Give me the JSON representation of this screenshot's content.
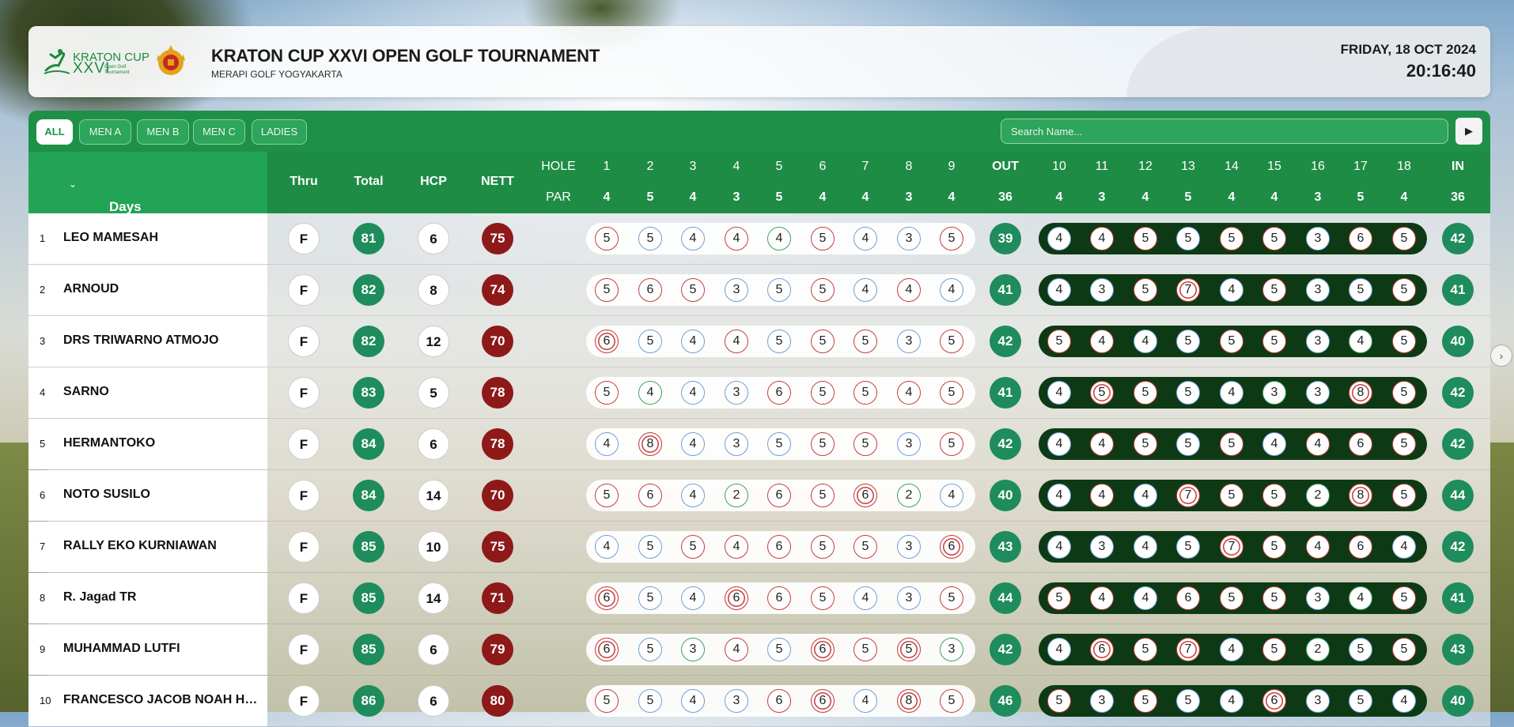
{
  "header": {
    "logo_line1": "KRATON CUP",
    "logo_line2": "XXVI",
    "logo_small": "Open Golf Tournament",
    "title": "KRATON CUP XXVI OPEN GOLF TOURNAMENT",
    "subtitle": "MERAPI GOLF YOGYAKARTA",
    "date": "FRIDAY, 18 OCT 2024",
    "time": "20:16:40"
  },
  "filters": [
    "ALL",
    "MEN A",
    "MEN B",
    "MEN C",
    "LADIES"
  ],
  "active_filter": "ALL",
  "search": {
    "placeholder": "Search Name..."
  },
  "go_icon": "play-icon",
  "columns": {
    "days": "Days",
    "thru": "Thru",
    "total": "Total",
    "hcp": "HCP",
    "nett": "NETT",
    "hole": "HOLE",
    "par": "PAR",
    "out": "OUT",
    "in": "IN",
    "holes": [
      "1",
      "2",
      "3",
      "4",
      "5",
      "6",
      "7",
      "8",
      "9",
      "10",
      "11",
      "12",
      "13",
      "14",
      "15",
      "16",
      "17",
      "18"
    ],
    "pars": [
      "4",
      "5",
      "4",
      "3",
      "5",
      "4",
      "4",
      "3",
      "4",
      "4",
      "3",
      "4",
      "5",
      "4",
      "4",
      "3",
      "5",
      "4"
    ],
    "out_par": "36",
    "in_par": "36"
  },
  "colors": {
    "green": "#1f9048",
    "dark_green": "#0d3a14",
    "nett_red": "#8e1919",
    "total_green": "#1e8c5c"
  },
  "players": [
    {
      "rank": "1",
      "name": "LEO MAMESAH",
      "thru": "F",
      "total": "81",
      "hcp": "6",
      "nett": "75",
      "out": "39",
      "in": "42",
      "scores": [
        "5",
        "5",
        "4",
        "4",
        "4",
        "5",
        "4",
        "3",
        "5",
        "4",
        "4",
        "5",
        "5",
        "5",
        "5",
        "3",
        "6",
        "5"
      ]
    },
    {
      "rank": "2",
      "name": "ARNOUD",
      "thru": "F",
      "total": "82",
      "hcp": "8",
      "nett": "74",
      "out": "41",
      "in": "41",
      "scores": [
        "5",
        "6",
        "5",
        "3",
        "5",
        "5",
        "4",
        "4",
        "4",
        "4",
        "3",
        "5",
        "7",
        "4",
        "5",
        "3",
        "5",
        "5"
      ]
    },
    {
      "rank": "3",
      "name": "DRS TRIWARNO ATMOJO",
      "thru": "F",
      "total": "82",
      "hcp": "12",
      "nett": "70",
      "out": "42",
      "in": "40",
      "scores": [
        "6",
        "5",
        "4",
        "4",
        "5",
        "5",
        "5",
        "3",
        "5",
        "5",
        "4",
        "4",
        "5",
        "5",
        "5",
        "3",
        "4",
        "5"
      ]
    },
    {
      "rank": "4",
      "name": "SARNO",
      "thru": "F",
      "total": "83",
      "hcp": "5",
      "nett": "78",
      "out": "41",
      "in": "42",
      "scores": [
        "5",
        "4",
        "4",
        "3",
        "6",
        "5",
        "5",
        "4",
        "5",
        "4",
        "5",
        "5",
        "5",
        "4",
        "3",
        "3",
        "8",
        "5"
      ]
    },
    {
      "rank": "5",
      "name": "HERMANTOKO",
      "thru": "F",
      "total": "84",
      "hcp": "6",
      "nett": "78",
      "out": "42",
      "in": "42",
      "scores": [
        "4",
        "8",
        "4",
        "3",
        "5",
        "5",
        "5",
        "3",
        "5",
        "4",
        "4",
        "5",
        "5",
        "5",
        "4",
        "4",
        "6",
        "5"
      ]
    },
    {
      "rank": "6",
      "name": "NOTO SUSILO",
      "thru": "F",
      "total": "84",
      "hcp": "14",
      "nett": "70",
      "out": "40",
      "in": "44",
      "scores": [
        "5",
        "6",
        "4",
        "2",
        "6",
        "5",
        "6",
        "2",
        "4",
        "4",
        "4",
        "4",
        "7",
        "5",
        "5",
        "2",
        "8",
        "5"
      ]
    },
    {
      "rank": "7",
      "name": "RALLY EKO KURNIAWAN",
      "thru": "F",
      "total": "85",
      "hcp": "10",
      "nett": "75",
      "out": "43",
      "in": "42",
      "scores": [
        "4",
        "5",
        "5",
        "4",
        "6",
        "5",
        "5",
        "3",
        "6",
        "4",
        "3",
        "4",
        "5",
        "7",
        "5",
        "4",
        "6",
        "4"
      ]
    },
    {
      "rank": "8",
      "name": "R. Jagad TR",
      "thru": "F",
      "total": "85",
      "hcp": "14",
      "nett": "71",
      "out": "44",
      "in": "41",
      "scores": [
        "6",
        "5",
        "4",
        "6",
        "6",
        "5",
        "4",
        "3",
        "5",
        "5",
        "4",
        "4",
        "6",
        "5",
        "5",
        "3",
        "4",
        "5"
      ]
    },
    {
      "rank": "9",
      "name": "MUHAMMAD LUTFI",
      "thru": "F",
      "total": "85",
      "hcp": "6",
      "nett": "79",
      "out": "42",
      "in": "43",
      "scores": [
        "6",
        "5",
        "3",
        "4",
        "5",
        "6",
        "5",
        "5",
        "3",
        "4",
        "6",
        "5",
        "7",
        "4",
        "5",
        "2",
        "5",
        "5"
      ]
    },
    {
      "rank": "10",
      "name": "FRANCESCO JACOB NOAH HA...",
      "thru": "F",
      "total": "86",
      "hcp": "6",
      "nett": "80",
      "out": "46",
      "in": "40",
      "scores": [
        "5",
        "5",
        "4",
        "3",
        "6",
        "6",
        "4",
        "8",
        "5",
        "5",
        "3",
        "5",
        "5",
        "4",
        "6",
        "3",
        "5",
        "4"
      ]
    }
  ]
}
